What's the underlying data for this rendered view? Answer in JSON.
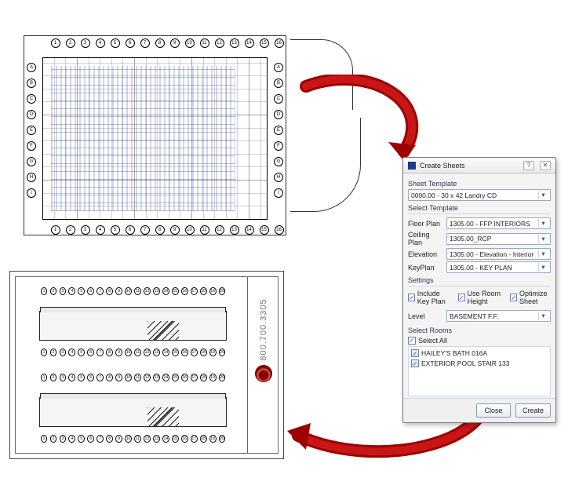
{
  "phone_number": "800.700.3305",
  "plan": {
    "cols": [
      "1",
      "2",
      "3",
      "4",
      "5",
      "6",
      "7",
      "8",
      "9",
      "10",
      "11",
      "12",
      "13",
      "14",
      "15",
      "16"
    ],
    "rows": [
      "A",
      "B",
      "C",
      "D",
      "E",
      "F",
      "G",
      "H",
      "I"
    ]
  },
  "elev": {
    "cols": [
      "1",
      "2",
      "3",
      "4",
      "5",
      "6",
      "7",
      "8",
      "9",
      "10",
      "11",
      "12",
      "13",
      "14",
      "15",
      "16",
      "17",
      "18",
      "19",
      "20"
    ]
  },
  "dialog": {
    "title": "Create Sheets",
    "sheet_template_label": "Sheet Template",
    "sheet_template_value": "0000.00 - 30 x 42 Landry CD",
    "select_template_label": "Select Template",
    "templates": {
      "floor_plan": {
        "label": "Floor Plan",
        "value": "1305.00 - FFP INTERIORS"
      },
      "ceiling_plan": {
        "label": "Ceiling Plan",
        "value": "1305.00_RCP"
      },
      "elevation": {
        "label": "Elevation",
        "value": "1305.00 - Elevation - Interior"
      },
      "key_plan": {
        "label": "KeyPlan",
        "value": "1305.00 - KEY PLAN"
      }
    },
    "settings_label": "Settings",
    "settings": {
      "include_key_plan": "Include Key Plan",
      "use_room_height": "Use Room Height",
      "optimize_sheet": "Optimize Sheet"
    },
    "level_label": "Level",
    "level_value": "BASEMENT F.F.",
    "select_rooms_label": "Select Rooms",
    "select_all_label": "Select All",
    "rooms": [
      "HAILEY'S BATH 016A",
      "EXTERIOR POOL STAIR 133"
    ],
    "close_label": "Close",
    "create_label": "Create"
  }
}
